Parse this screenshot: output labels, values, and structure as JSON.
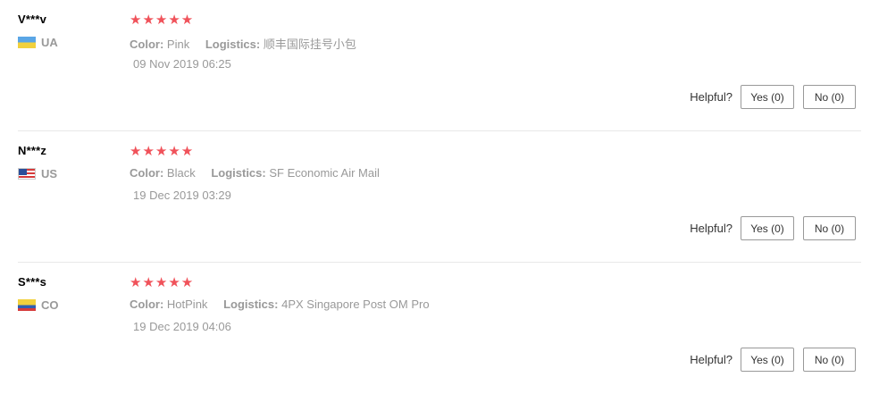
{
  "reviews": [
    {
      "user": "V***v",
      "country": "UA",
      "rating": "★★★★★",
      "color_label": "Color:",
      "color_value": "Pink",
      "logistics_label": "Logistics:",
      "logistics_value": "顺丰国际挂号小包",
      "date": "09 Nov 2019 06:25",
      "helpful_label": "Helpful?",
      "yes_label": "Yes (0)",
      "no_label": "No (0)"
    },
    {
      "user": "N***z",
      "country": "US",
      "rating": "★★★★★",
      "color_label": "Color:",
      "color_value": "Black",
      "logistics_label": "Logistics:",
      "logistics_value": "SF Economic Air Mail",
      "date": "19 Dec 2019 03:29",
      "helpful_label": "Helpful?",
      "yes_label": "Yes (0)",
      "no_label": "No (0)"
    },
    {
      "user": "S***s",
      "country": "CO",
      "rating": "★★★★★",
      "color_label": "Color:",
      "color_value": "HotPink",
      "logistics_label": "Logistics:",
      "logistics_value": "4PX Singapore Post OM Pro",
      "date": "19 Dec 2019 04:06",
      "helpful_label": "Helpful?",
      "yes_label": "Yes (0)",
      "no_label": "No (0)"
    }
  ],
  "colors": {
    "star": "#f0525a",
    "muted_text": "#999999",
    "divider": "#e8e8e8"
  }
}
